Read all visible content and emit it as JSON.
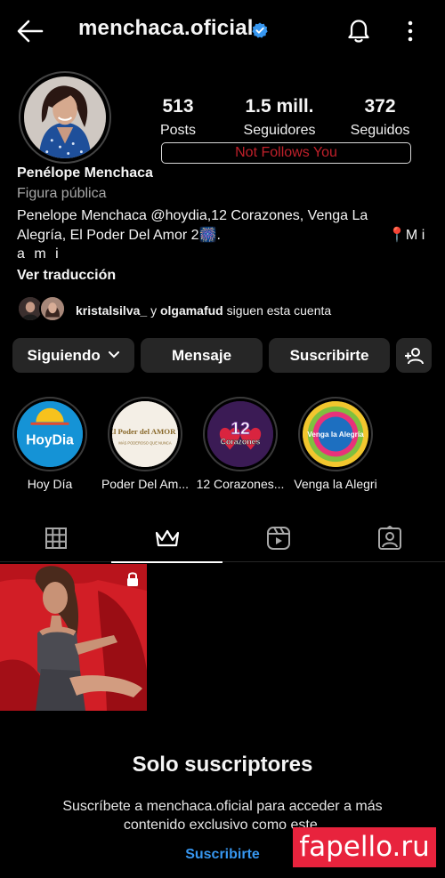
{
  "header": {
    "username": "menchaca.oficial"
  },
  "stats": {
    "posts_count": "513",
    "posts_label": "Posts",
    "followers_count": "1.5 mill.",
    "followers_label": "Seguidores",
    "following_count": "372",
    "following_label": "Seguidos"
  },
  "follow_status": "Not Follows You",
  "profile": {
    "name": "Penélope Menchaca",
    "category": "Figura pública",
    "bio": "Penelope Menchaca @hoydia,12 Corazones, Venga La Alegría, El Poder Del Amor 2🎆.",
    "bio_location": "📍M i",
    "bio_tail": "a m i",
    "translate_link": "Ver traducción"
  },
  "followed_by": {
    "user1": "kristalsilva_",
    "connector": "y",
    "user2": "olgamafud",
    "suffix": "siguen esta cuenta"
  },
  "actions": {
    "following_label": "Siguiendo",
    "message_label": "Mensaje",
    "subscribe_label": "Suscribirte"
  },
  "highlights": [
    {
      "label": "Hoy Día",
      "logo_text": "HoyDia"
    },
    {
      "label": "Poder Del Am...",
      "logo_text": "El Poder del AMOR 2",
      "logo_sub": "MÁS PODEROSO QUE NUNCA"
    },
    {
      "label": "12 Corazones...",
      "logo_text": "12",
      "logo_sub": "Corazones"
    },
    {
      "label": "Venga la Alegri",
      "logo_text": "Venga la Alegría"
    }
  ],
  "tabs": [
    "posts-grid",
    "subscriber-content",
    "reels",
    "tagged"
  ],
  "active_tab": "subscriber-content",
  "exclusive": {
    "title": "Solo suscriptores",
    "description": "Suscríbete a menchaca.oficial para acceder a más contenido exclusivo como este.",
    "link": "Suscribirte"
  },
  "watermark": "fapello.ru",
  "colors": {
    "background": "#000000",
    "button": "#262626",
    "verified": "#3797f0",
    "link": "#3797f0",
    "follow_status_text": "#c0202a",
    "watermark_bg": "#e8233d"
  }
}
